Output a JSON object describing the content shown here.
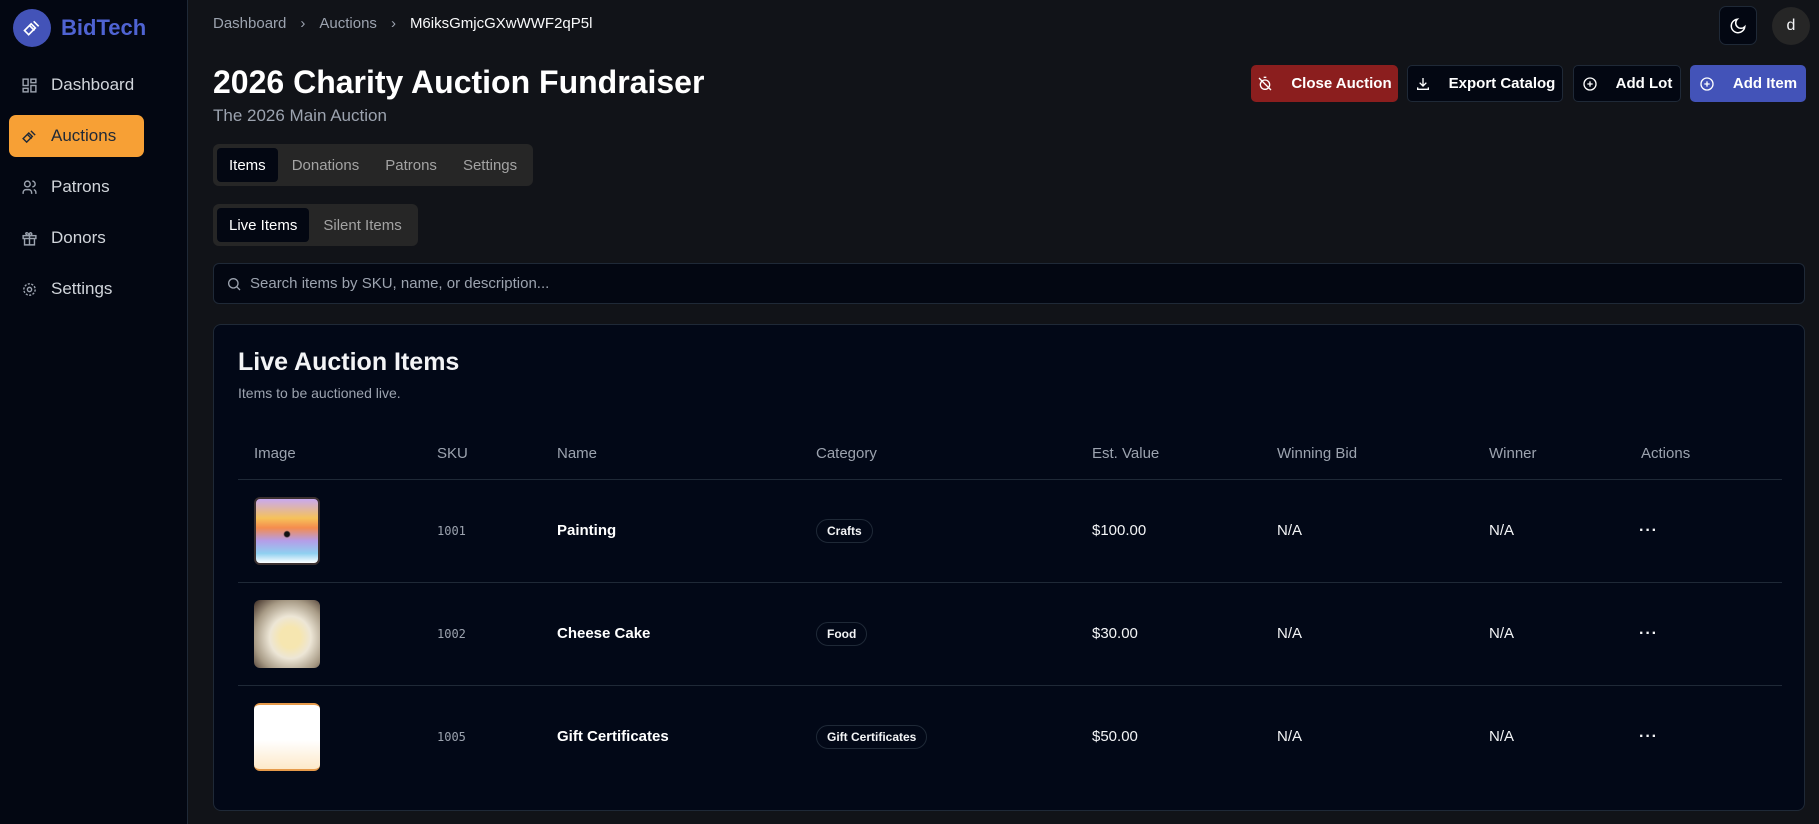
{
  "app": {
    "name": "BidTech"
  },
  "sidebar": {
    "items": [
      {
        "label": "Dashboard"
      },
      {
        "label": "Auctions"
      },
      {
        "label": "Patrons"
      },
      {
        "label": "Donors"
      },
      {
        "label": "Settings"
      }
    ]
  },
  "breadcrumb": [
    "Dashboard",
    "Auctions",
    "M6iksGmjcGXwWWF2qP5l"
  ],
  "header": {
    "title": "2026 Charity Auction Fundraiser",
    "subtitle": "The 2026 Main Auction",
    "avatar": "d"
  },
  "actions": {
    "close": "Close Auction",
    "export": "Export Catalog",
    "add_lot": "Add Lot",
    "add_item": "Add Item"
  },
  "colors": {
    "accent": "#f7a035",
    "brand": "#4353b8",
    "danger": "#8b1e1e"
  },
  "tabs": [
    "Items",
    "Donations",
    "Patrons",
    "Settings"
  ],
  "subtabs": [
    "Live Items",
    "Silent Items"
  ],
  "search": {
    "placeholder": "Search items by SKU, name, or description..."
  },
  "card": {
    "title": "Live Auction Items",
    "subtitle": "Items to be auctioned live.",
    "columns": [
      "Image",
      "SKU",
      "Name",
      "Category",
      "Est. Value",
      "Winning Bid",
      "Winner",
      "Actions"
    ],
    "rows": [
      {
        "sku": "1001",
        "name": "Painting",
        "category": "Crafts",
        "est": "$100.00",
        "bid": "N/A",
        "winner": "N/A"
      },
      {
        "sku": "1002",
        "name": "Cheese Cake",
        "category": "Food",
        "est": "$30.00",
        "bid": "N/A",
        "winner": "N/A"
      },
      {
        "sku": "1005",
        "name": "Gift Certificates",
        "category": "Gift Certificates",
        "est": "$50.00",
        "bid": "N/A",
        "winner": "N/A"
      }
    ]
  }
}
